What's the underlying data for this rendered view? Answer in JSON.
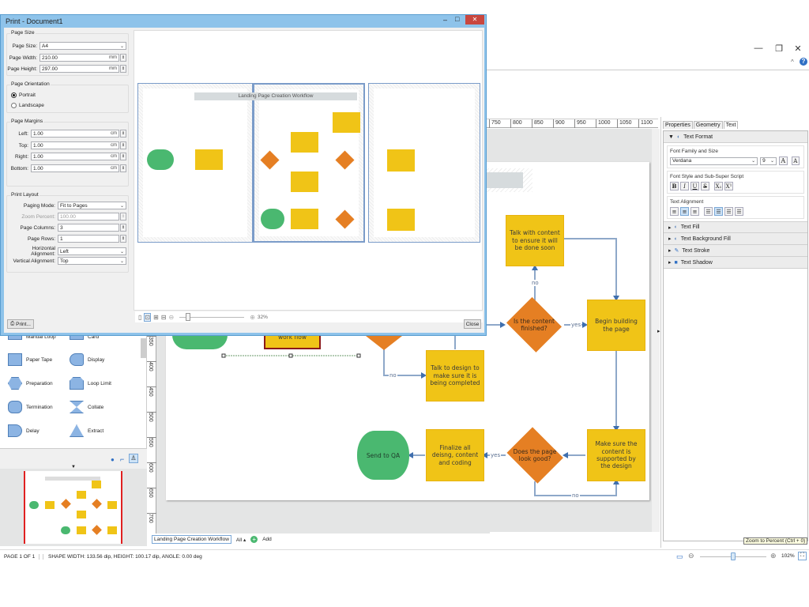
{
  "app": {
    "window_controls": {
      "minimize": "—",
      "maximize": "❐",
      "close": "✕"
    },
    "help_icon": "?",
    "collapse_icon": "^"
  },
  "ruler_h": [
    "750",
    "800",
    "850",
    "900",
    "950",
    "1000",
    "1050",
    "1100"
  ],
  "ruler_v": [
    "350",
    "400",
    "450",
    "500",
    "550",
    "600",
    "650",
    "700"
  ],
  "diagram": {
    "title": "Landing Page Creation Workflow",
    "shapes": {
      "talk_content": "Talk with content to ensure it will be done soon",
      "content_finished": "Is the content finished?",
      "begin_building": "Begin building the page",
      "talk_design": "Talk to design to make sure it is being completed",
      "send_qa": "Send to QA",
      "finalize": "Finalize all deisng, content and coding",
      "page_good": "Does the page look good?",
      "make_sure": "Make sure the content is supported by the design",
      "work_flow": "work flow"
    },
    "labels": {
      "no": "no",
      "yes": "yes"
    }
  },
  "right_panel": {
    "tabs": [
      "Properties",
      "Geometry",
      "Text"
    ],
    "active_tab": "Text",
    "text_format": {
      "header": "Text Format",
      "font_group": "Font Family and Size",
      "font_family": "Verdana",
      "font_size": "9",
      "style_group": "Font Style and Sub-Super Script",
      "style_buttons": [
        "B",
        "I",
        "U",
        "S",
        "X₁",
        "X¹"
      ],
      "align_group": "Text Alignment"
    },
    "sections": [
      "Text Fill",
      "Text Background Fill",
      "Text Stroke",
      "Text Shadow"
    ],
    "tooltip": "Zoom to Percent (Ctrl + 0)"
  },
  "shapes_panel": {
    "items": [
      {
        "label": "Manual Loop"
      },
      {
        "label": "Card"
      },
      {
        "label": "Paper Tape"
      },
      {
        "label": "Display"
      },
      {
        "label": "Preparation"
      },
      {
        "label": "Loop Limit"
      },
      {
        "label": "Termination"
      },
      {
        "label": "Collate"
      },
      {
        "label": "Delay"
      },
      {
        "label": "Extract"
      }
    ]
  },
  "page_tabs": {
    "current": "Landing Page Creation Workflow",
    "all": "All ▴",
    "add": "Add"
  },
  "status": {
    "page": "PAGE 1 OF 1",
    "shape_info": "SHAPE WIDTH: 133.56 dip, HEIGHT: 100.17 dip, ANGLE: 0.00 deg",
    "zoom": "102%",
    "zoom_fraction": 0.5
  },
  "print_dialog": {
    "title": "Print - Document1",
    "page_size": {
      "legend": "Page Size",
      "size_label": "Page Size:",
      "size_value": "A4",
      "width_label": "Page Width:",
      "width_value": "210.00",
      "width_unit": "mm",
      "height_label": "Page Height:",
      "height_value": "297.00",
      "height_unit": "mm"
    },
    "orientation": {
      "legend": "Page Orientation",
      "portrait": "Portrait",
      "landscape": "Landscape",
      "selected": "Portrait"
    },
    "margins": {
      "legend": "Page Margins",
      "items": [
        {
          "label": "Left:",
          "value": "1.00",
          "unit": "cm"
        },
        {
          "label": "Top:",
          "value": "1.00",
          "unit": "cm"
        },
        {
          "label": "Right:",
          "value": "1.00",
          "unit": "cm"
        },
        {
          "label": "Bottom:",
          "value": "1.00",
          "unit": "cm"
        }
      ]
    },
    "layout": {
      "legend": "Print Layout",
      "paging_mode_label": "Paging Mode:",
      "paging_mode": "Fit to Pages",
      "zoom_label": "Zoom Percent:",
      "zoom_value": "100.00",
      "columns_label": "Page Columns:",
      "columns_value": "3",
      "rows_label": "Page Rows:",
      "rows_value": "1",
      "halign_label": "Horizontal Alignment:",
      "halign_value": "Left",
      "valign_label": "Vertical Alignment:",
      "valign_value": "Top"
    },
    "preview_zoom": "32%",
    "preview_zoom_fraction": 0.1,
    "print_button": "Print...",
    "close_button": "Close"
  }
}
